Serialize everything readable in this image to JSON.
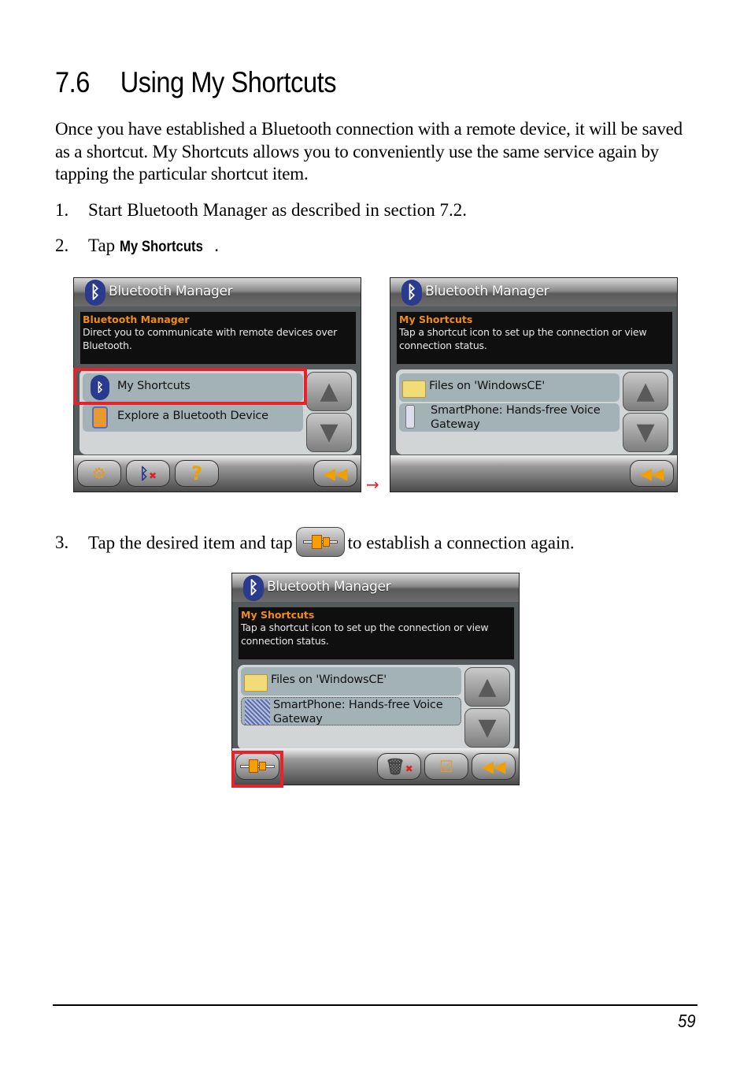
{
  "section": {
    "number": "7.6",
    "title": "Using My Shortcuts"
  },
  "intro": "Once you have established a Bluetooth connection with a remote device, it will be saved as a shortcut. My Shortcuts allows you to conveniently use the same service again by tapping the particular shortcut item.",
  "steps": [
    {
      "num": "1.",
      "text": "Start Bluetooth Manager as described in section 7.2."
    },
    {
      "num": "2.",
      "pre": "Tap ",
      "bold": "My Shortcuts",
      "post": "."
    },
    {
      "num": "3.",
      "pre": "Tap the desired item and tap",
      "post": "to establish a connection again.",
      "icon": "connect-icon"
    }
  ],
  "screens": [
    {
      "app_title": "Bluetooth Manager",
      "info_title": "Bluetooth Manager",
      "info_text": "Direct you to communicate with remote devices over Bluetooth.",
      "items": [
        {
          "label": "My Shortcuts",
          "icon": "bluetooth-shortcut-icon",
          "highlighted": true
        },
        {
          "label": "Explore a Bluetooth Device",
          "icon": "explore-device-icon"
        }
      ],
      "toolbar": [
        "settings-icon",
        "bluetooth-off-icon",
        "help-icon",
        "exit-icon"
      ]
    },
    {
      "app_title": "Bluetooth Manager",
      "info_title": "My Shortcuts",
      "info_text": "Tap a shortcut icon to set up the connection or view connection status.",
      "items": [
        {
          "label": "Files on 'WindowsCE'",
          "icon": "folder-icon"
        },
        {
          "label": "SmartPhone: Hands-free Voice Gateway",
          "icon": "phone-headset-icon"
        }
      ],
      "toolbar": [
        "back-icon"
      ]
    },
    {
      "app_title": "Bluetooth Manager",
      "info_title": "My Shortcuts",
      "info_text": "Tap a shortcut icon to set up the connection or view connection status.",
      "items": [
        {
          "label": "Files on 'WindowsCE'",
          "icon": "folder-icon"
        },
        {
          "label": "SmartPhone: Hands-free Voice Gateway",
          "icon": "phone-headset-icon",
          "selected": true
        }
      ],
      "toolbar": [
        "connect-icon",
        "delete-icon",
        "properties-icon",
        "back-icon"
      ]
    }
  ],
  "arrow": "→",
  "page_number": "59",
  "colors": {
    "highlight": "#e8222a",
    "info_title": "#f08c14",
    "bluetooth": "#2a3a8c"
  }
}
